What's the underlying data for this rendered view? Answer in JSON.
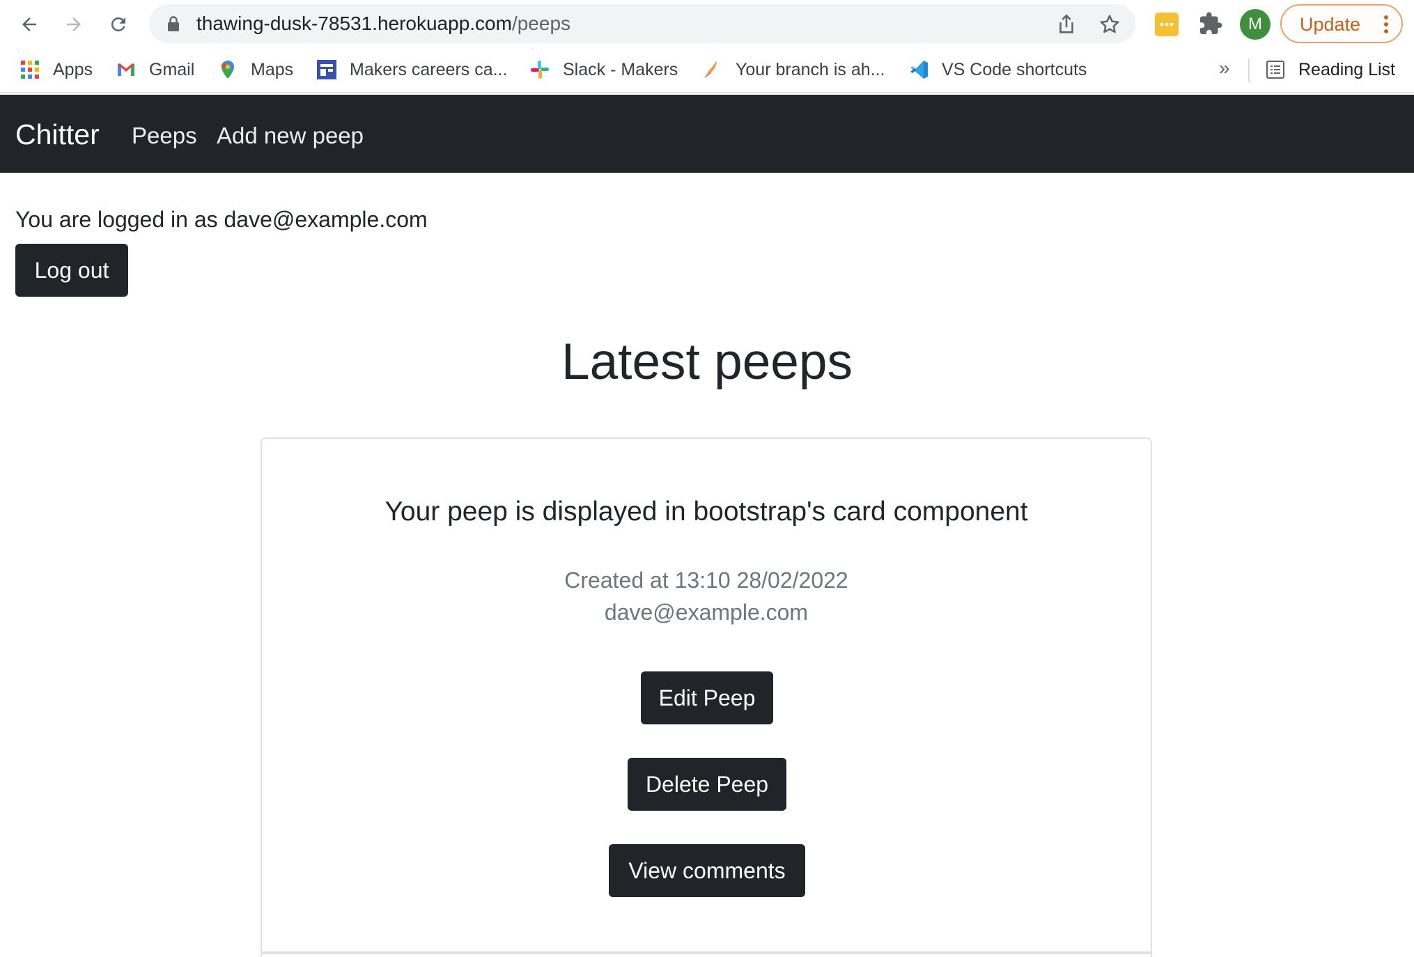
{
  "browser": {
    "url_host": "thawing-dusk-78531.herokuapp.com",
    "url_path": "/peeps",
    "profile_initial": "M",
    "update_label": "Update",
    "bookmarks": [
      {
        "label": "Apps",
        "icon": "apps-grid-icon"
      },
      {
        "label": "Gmail",
        "icon": "gmail-icon"
      },
      {
        "label": "Maps",
        "icon": "maps-icon"
      },
      {
        "label": "Makers careers ca...",
        "icon": "makers-careers-icon"
      },
      {
        "label": "Slack - Makers",
        "icon": "slack-icon"
      },
      {
        "label": "Your branch is ah...",
        "icon": "branch-bookmark-icon"
      },
      {
        "label": "VS Code shortcuts",
        "icon": "vscode-icon"
      }
    ],
    "more_bookmarks": "»",
    "reading_list": "Reading List"
  },
  "navbar": {
    "brand": "Chitter",
    "links": [
      "Peeps",
      "Add new peep"
    ]
  },
  "session": {
    "logged_in_text": "You are logged in as dave@example.com",
    "logout_label": "Log out"
  },
  "main": {
    "title": "Latest peeps",
    "peep": {
      "text": "Your peep is displayed in bootstrap's card component",
      "created": "Created at 13:10 28/02/2022",
      "author": "dave@example.com",
      "edit_label": "Edit Peep",
      "delete_label": "Delete Peep",
      "comments_label": "View comments"
    }
  },
  "colors": {
    "navbar_bg": "#212529",
    "button_bg": "#212529",
    "muted_text": "#6c757d",
    "update_accent": "#c5621a"
  }
}
